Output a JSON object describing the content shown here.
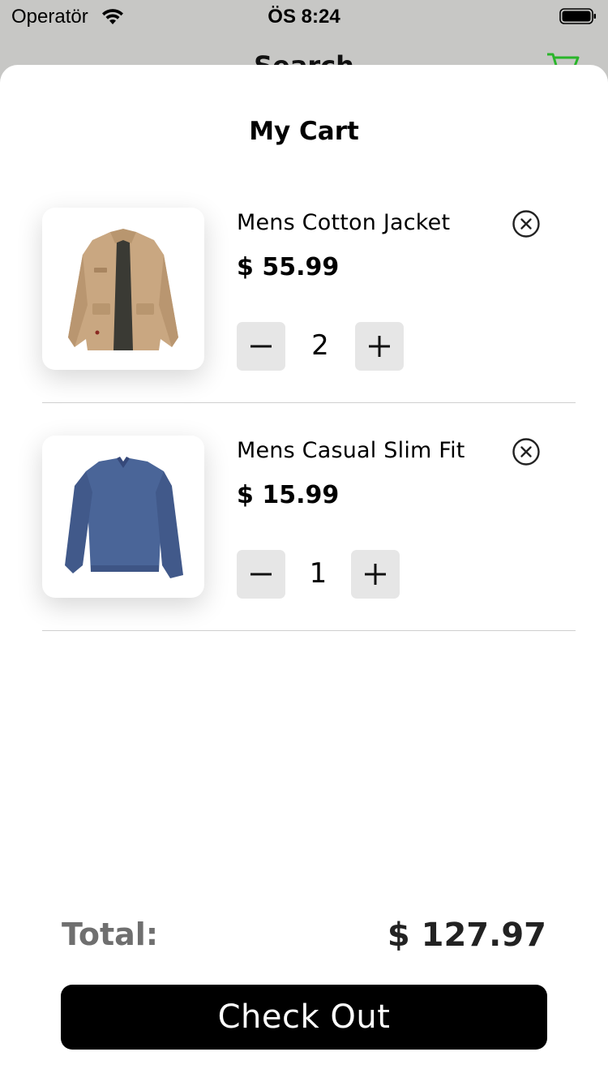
{
  "status_bar": {
    "carrier": "Operatör",
    "time": "ÖS 8:24"
  },
  "background_screen": {
    "title": "Search",
    "cart_icon": "cart-icon",
    "cart_icon_color": "#2ab52a"
  },
  "sheet": {
    "title": "My Cart",
    "items": [
      {
        "name": "Mens Cotton Jacket",
        "price": "$ 55.99",
        "quantity": "2",
        "image": "jacket-image"
      },
      {
        "name": "Mens Casual Slim Fit",
        "price": "$ 15.99",
        "quantity": "1",
        "image": "tshirt-image"
      }
    ],
    "total_label": "Total:",
    "total_value": "$ 127.97",
    "checkout_label": "Check Out"
  }
}
